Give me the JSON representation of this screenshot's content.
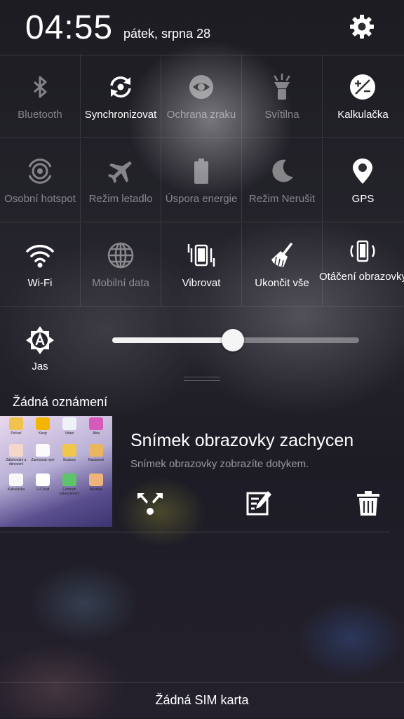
{
  "status": {
    "time": "04:55",
    "date": "pátek, srpna 28"
  },
  "toggles": [
    {
      "label": "Bluetooth",
      "icon": "bluetooth-icon",
      "active": false
    },
    {
      "label": "Synchronizovat",
      "icon": "sync-icon",
      "active": true
    },
    {
      "label": "Ochrana zraku",
      "icon": "eye-icon",
      "active": false
    },
    {
      "label": "Svítilna",
      "icon": "flashlight-icon",
      "active": false
    },
    {
      "label": "Kalkulačka",
      "icon": "calculator-icon",
      "active": true
    },
    {
      "label": "Osobní hotspot",
      "icon": "hotspot-icon",
      "active": false
    },
    {
      "label": "Režim letadlo",
      "icon": "airplane-icon",
      "active": false
    },
    {
      "label": "Úspora energie",
      "icon": "battery-icon",
      "active": false
    },
    {
      "label": "Režim Nerušit",
      "icon": "moon-icon",
      "active": false
    },
    {
      "label": "GPS",
      "icon": "location-pin-icon",
      "active": true
    },
    {
      "label": "Wi-Fi",
      "icon": "wifi-icon",
      "active": true
    },
    {
      "label": "Mobilní data",
      "icon": "globe-icon",
      "active": false
    },
    {
      "label": "Vibrovat",
      "icon": "vibrate-icon",
      "active": true
    },
    {
      "label": "Ukončit vše",
      "icon": "broom-icon",
      "active": true
    },
    {
      "label": "Otáčení obrazovky",
      "icon": "rotate-screen-icon",
      "active": true
    }
  ],
  "brightness": {
    "label": "Jas",
    "level": 0.49
  },
  "notifications": {
    "header": "Žádná oznámení",
    "item": {
      "title": "Snímek obrazovky zachycen",
      "subtitle": "Snímek obrazovky zobrazíte dotykem.",
      "thumbnail_apps": [
        "Počasí",
        "Keep",
        "Video",
        "Alba",
        "Zálohování a obnovení",
        "Zamknout nyní",
        "Soubory",
        "Nastavení",
        "Kalkulačka",
        "O-Cloud",
        "Centrum zabezpečení",
        "Nástroje"
      ],
      "actions": [
        "share-icon",
        "edit-icon",
        "trash-icon"
      ]
    }
  },
  "footer": {
    "sim_status": "Žádná SIM karta"
  }
}
